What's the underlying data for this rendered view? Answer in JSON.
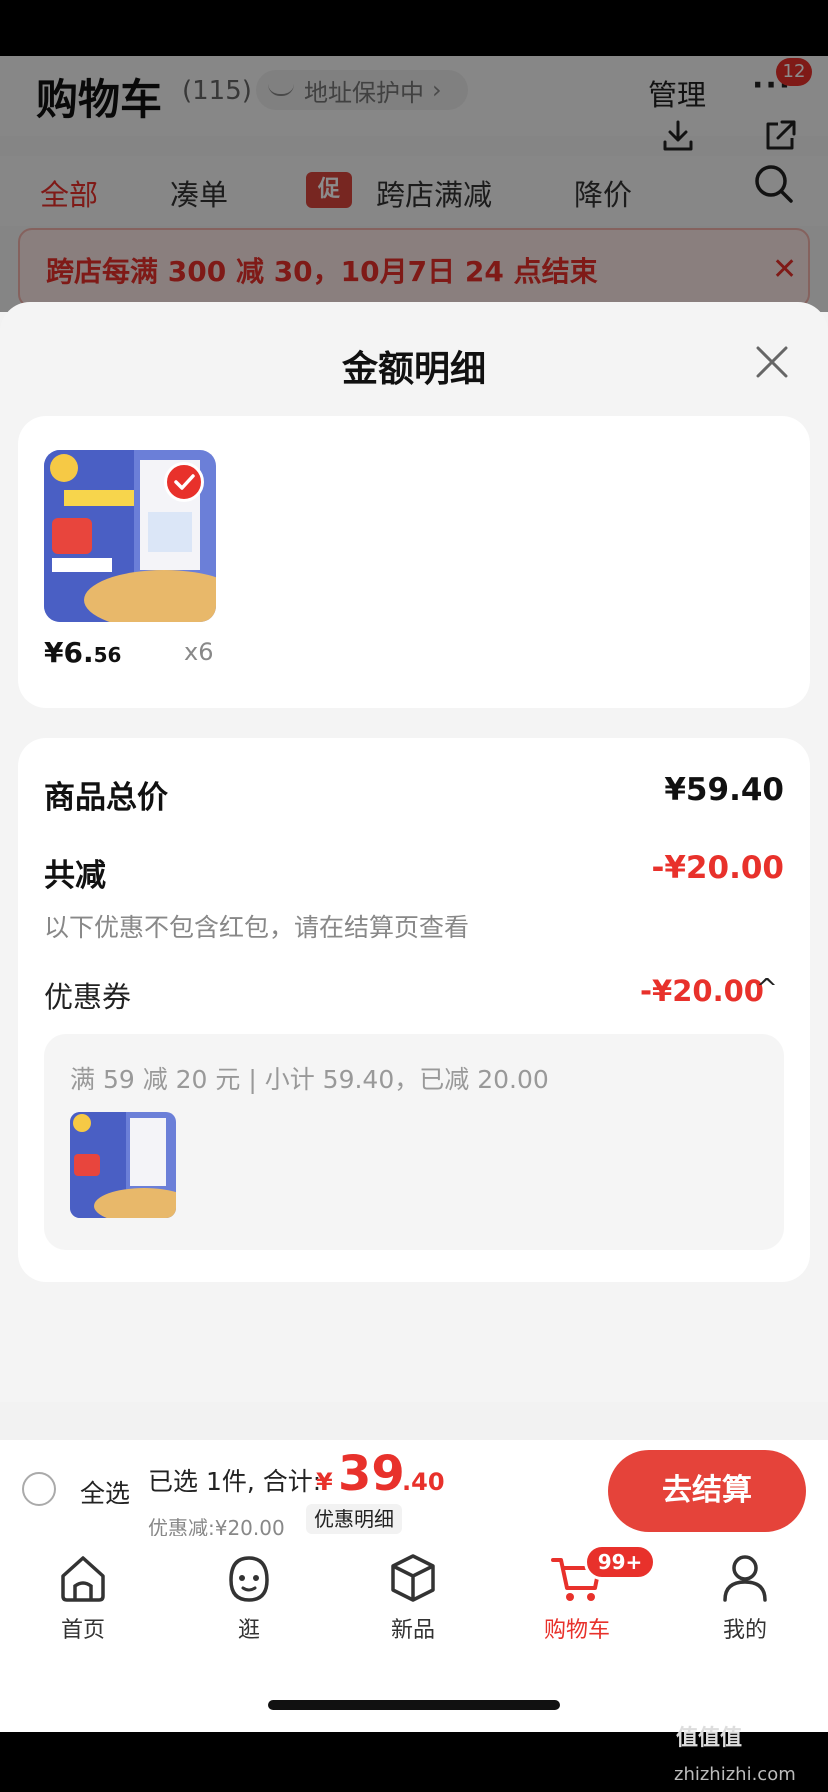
{
  "cart": {
    "title": "购物车",
    "count": "(115)",
    "address_pill": "地址保护中",
    "address_chevron": "›",
    "manage": "管理",
    "more": "···",
    "msg_badge": "12"
  },
  "tabs": {
    "all": "全部",
    "combine": "凑单",
    "promo_tag": "促",
    "promo": "跨店满减",
    "price_drop": "降价"
  },
  "notice": {
    "text": "跨店每满 300 减 30，10月7日 24 点结束",
    "close": "✕"
  },
  "sheet": {
    "title": "金额明细"
  },
  "item": {
    "price_int": "¥6.",
    "price_cents": "56",
    "qty": "x6"
  },
  "summary": {
    "goods_total_label": "商品总价",
    "goods_total_value": "¥59.40",
    "total_discount_label": "共减",
    "total_discount_value": "-¥20.00",
    "note": "以下优惠不包含红包，请在结算页查看",
    "coupon_label": "优惠券",
    "coupon_value": "-¥20.00",
    "coupon_caret": "^",
    "coupon_detail": "满 59 减 20 元 | 小计 59.40，已减 20.00"
  },
  "footer": {
    "select_all": "全选",
    "selected": "已选 1件, 合计:",
    "currency": "¥",
    "total_int": "39",
    "total_dec": ".40",
    "discount": "优惠减:¥20.00",
    "detail_link": "优惠明细",
    "checkout": "去结算"
  },
  "tabbar": {
    "home": "首页",
    "browse": "逛",
    "new": "新品",
    "cart": "购物车",
    "me": "我的",
    "cart_badge": "99+"
  },
  "watermark": {
    "brand": "值值值",
    "url": "zhizhizhi.com"
  },
  "colors": {
    "accent": "#e8312b",
    "checkout": "#e5433a",
    "sheet_bg": "#f4f4f4"
  }
}
